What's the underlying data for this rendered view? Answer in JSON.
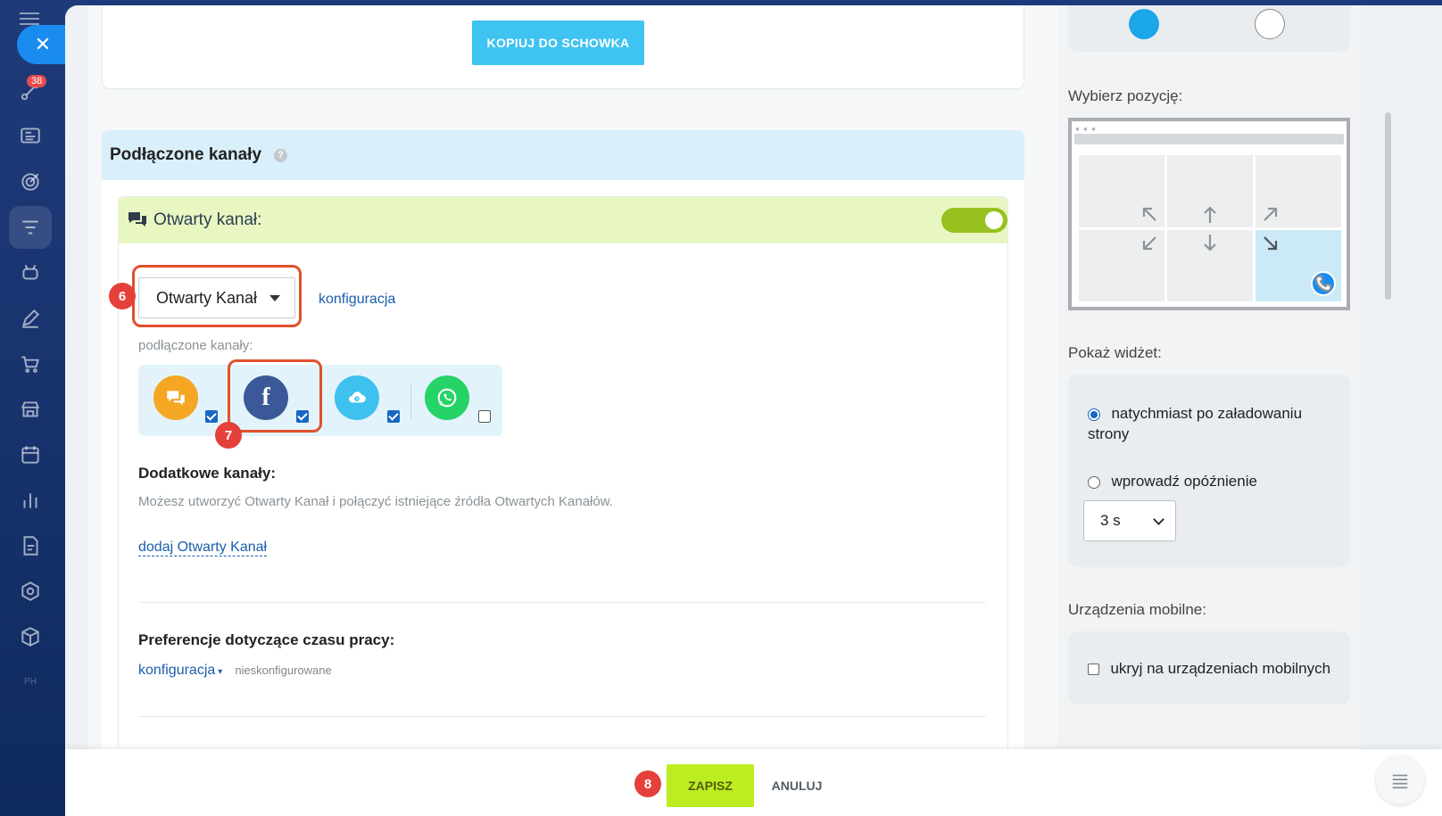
{
  "rail": {
    "badge_count": "38",
    "icons": [
      "menu-icon",
      "close-icon",
      "activity-icon",
      "news-icon",
      "target-icon",
      "filter-icon",
      "robot-icon",
      "pen-icon",
      "cart-icon",
      "store-icon",
      "calendar-icon",
      "chart-icon",
      "document-icon",
      "hexagon-icon",
      "box-icon",
      "ph-icon"
    ]
  },
  "top_card": {
    "copy_button": "KOPIUJ DO SCHOWKA"
  },
  "channels": {
    "title": "Podłączone kanały",
    "help": "?",
    "open_channel": {
      "title": "Otwarty kanał:",
      "enabled": true,
      "selected": "Otwarty Kanał",
      "config_link": "konfiguracja",
      "connected_label": "podłączone kanały:",
      "items": [
        {
          "name": "chat-icon",
          "color": "#f5a623",
          "checked": true
        },
        {
          "name": "facebook-icon",
          "color": "#3b5998",
          "checked": true
        },
        {
          "name": "cloud-clock-icon",
          "color": "#3ec1ee",
          "checked": true
        },
        {
          "name": "whatsapp-icon",
          "color": "#25d366",
          "checked": false
        }
      ],
      "extra_title": "Dodatkowe kanały:",
      "extra_desc": "Możesz utworzyć Otwarty Kanał i połączyć istniejące źródła Otwartych Kanałów.",
      "add_link": "dodaj Otwarty Kanał",
      "worktime_title": "Preferencje dotyczące czasu pracy:",
      "worktime_link": "konfiguracja",
      "worktime_status": "nieskonfigurowane"
    }
  },
  "badges": {
    "step6": "6",
    "step7": "7",
    "step8": "8"
  },
  "right": {
    "colors": [
      "#1aa6e8",
      "#ffffff"
    ],
    "position_label": "Wybierz pozycję:",
    "selected_position": "bottom-right",
    "show_label": "Pokaż widżet:",
    "option_immediate": "natychmiast po załadowaniu strony",
    "option_delay": "wprowadź opóźnienie",
    "immediate_selected": true,
    "delay_value": "3 s",
    "mobile_label": "Urządzenia mobilne:",
    "mobile_hide": "ukryj na urządzeniach mobilnych",
    "mobile_hide_checked": false
  },
  "footer": {
    "save": "ZAPISZ",
    "cancel": "ANULUJ"
  }
}
